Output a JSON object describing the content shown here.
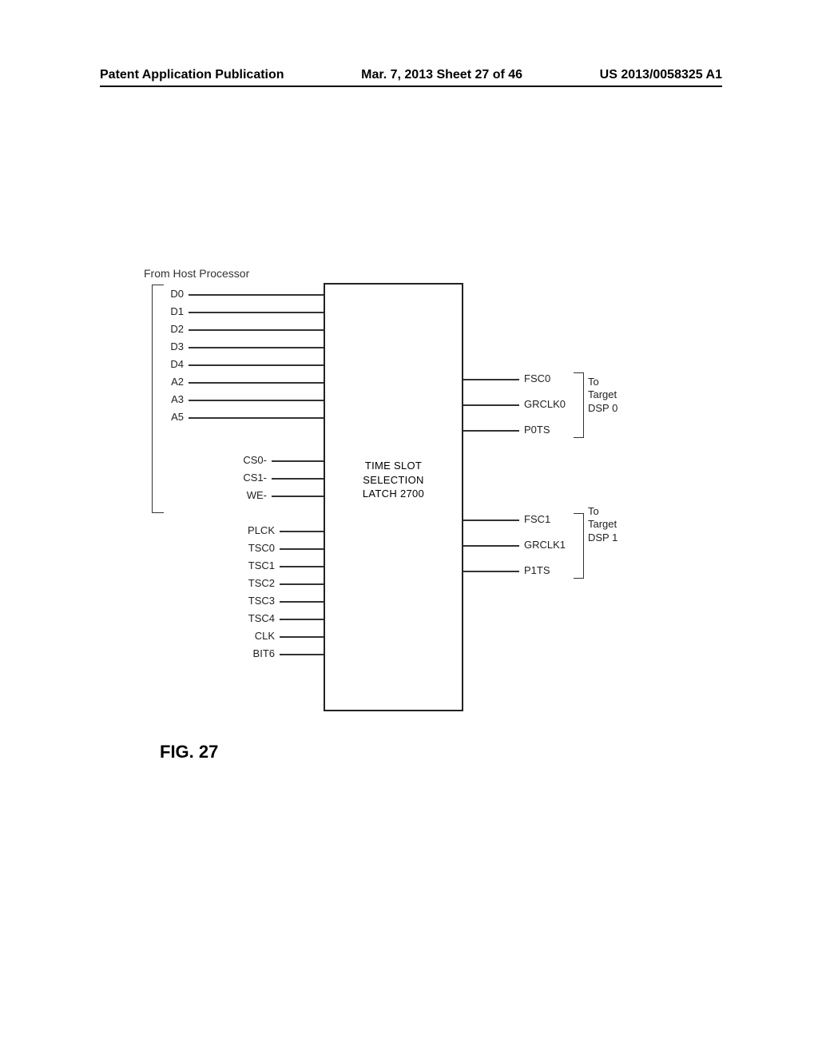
{
  "header": {
    "left": "Patent Application Publication",
    "center": "Mar. 7, 2013  Sheet 27 of 46",
    "right": "US 2013/0058325 A1"
  },
  "diagram": {
    "host_title": "From Host Processor",
    "block_label_line1": "TIME SLOT",
    "block_label_line2": "SELECTION",
    "block_label_line3": "LATCH 2700",
    "left_pins_group1": [
      "D0",
      "D1",
      "D2",
      "D3",
      "D4",
      "A2",
      "A3",
      "A5"
    ],
    "left_pins_group2": [
      "CS0-",
      "CS1-",
      "WE-"
    ],
    "left_pins_group3": [
      "PLCK",
      "TSC0",
      "TSC1",
      "TSC2",
      "TSC3",
      "TSC4",
      "CLK",
      "BIT6"
    ],
    "right_group0": {
      "label_line1": "To",
      "label_line2": "Target",
      "label_line3": "DSP 0",
      "pins": [
        "FSC0",
        "GRCLK0",
        "P0TS"
      ]
    },
    "right_group1": {
      "label_line1": "To",
      "label_line2": "Target",
      "label_line3": "DSP 1",
      "pins": [
        "FSC1",
        "GRCLK1",
        "P1TS"
      ]
    }
  },
  "figure_label": "FIG. 27"
}
